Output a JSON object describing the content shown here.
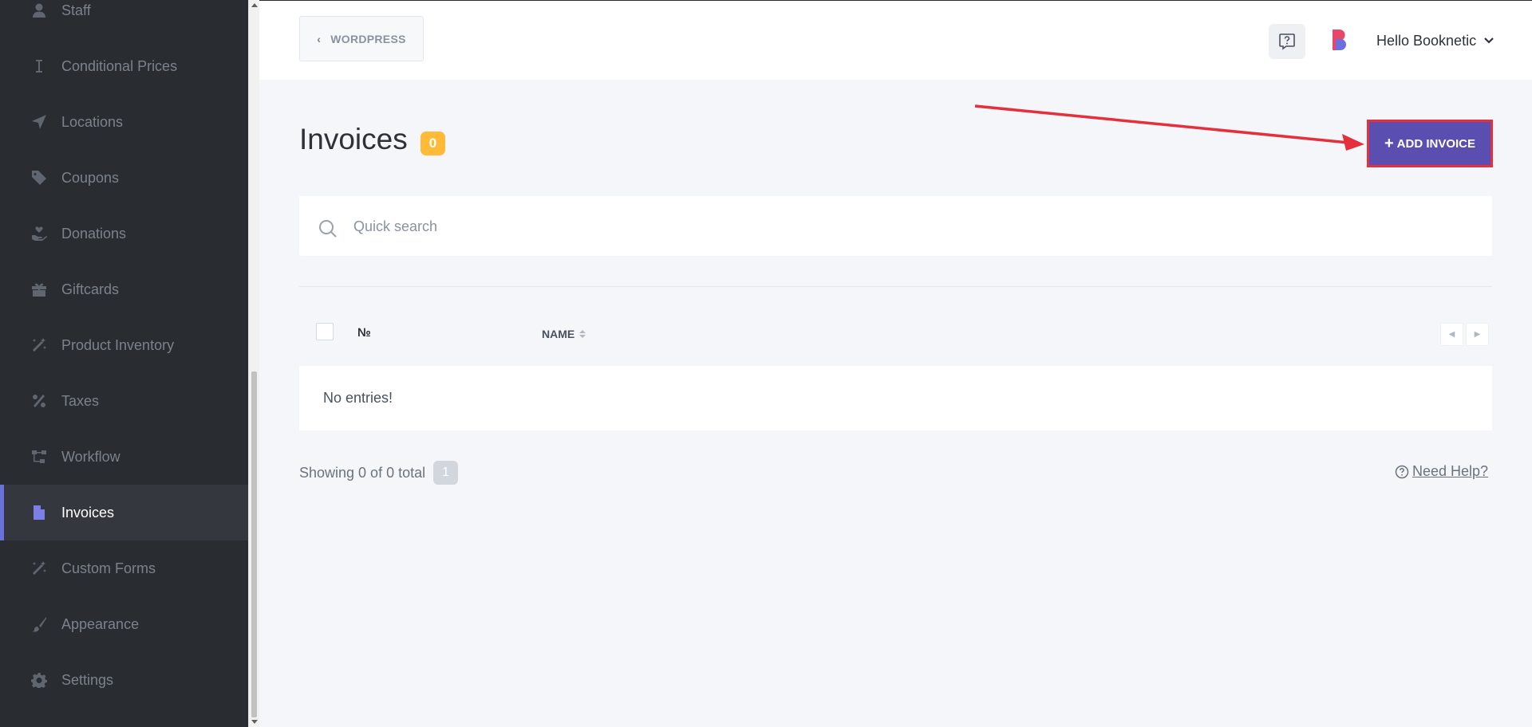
{
  "sidebar": {
    "items": [
      {
        "label": "Staff",
        "icon": "user-icon"
      },
      {
        "label": "Conditional Prices",
        "icon": "text-cursor-icon"
      },
      {
        "label": "Locations",
        "icon": "location-arrow-icon"
      },
      {
        "label": "Coupons",
        "icon": "tag-icon"
      },
      {
        "label": "Donations",
        "icon": "hand-holding-heart-icon"
      },
      {
        "label": "Giftcards",
        "icon": "gift-icon"
      },
      {
        "label": "Product Inventory",
        "icon": "magic-wand-icon"
      },
      {
        "label": "Taxes",
        "icon": "percent-icon"
      },
      {
        "label": "Workflow",
        "icon": "workflow-icon"
      },
      {
        "label": "Invoices",
        "icon": "file-invoice-icon",
        "active": true
      },
      {
        "label": "Custom Forms",
        "icon": "magic-wand-icon"
      },
      {
        "label": "Appearance",
        "icon": "paint-brush-icon"
      },
      {
        "label": "Settings",
        "icon": "gear-icon"
      }
    ]
  },
  "header": {
    "back_label": "WORDPRESS",
    "user_greeting": "Hello Booknetic"
  },
  "page": {
    "title": "Invoices",
    "count": "0",
    "add_button_label": "ADD INVOICE"
  },
  "search": {
    "placeholder": "Quick search"
  },
  "table": {
    "col_number": "№",
    "col_name": "NAME",
    "empty_text": "No entries!"
  },
  "footer": {
    "showing_text": "Showing 0 of 0 total",
    "page_number": "1",
    "help_label": "Need Help?"
  },
  "colors": {
    "sidebar_bg": "#292d32",
    "accent": "#6c70dc",
    "add_button": "#5a4fb0",
    "badge": "#ffbb38",
    "annotation_red": "#e3303c"
  }
}
